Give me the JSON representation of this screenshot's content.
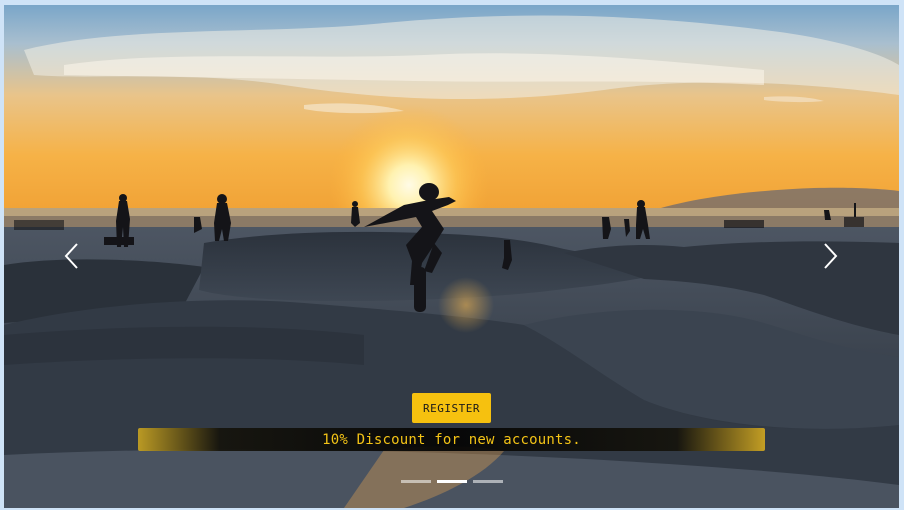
{
  "carousel": {
    "slide": {
      "image_icon": "skatepark-sunset-photo",
      "button_label": "REGISTER",
      "caption": "10% Discount for new accounts."
    },
    "prev_icon": "chevron-left-icon",
    "next_icon": "chevron-right-icon",
    "indicators": [
      {
        "active": false
      },
      {
        "active": true
      },
      {
        "active": false
      }
    ]
  },
  "colors": {
    "accent": "#f6c10f",
    "caption_text": "#f3c316"
  }
}
